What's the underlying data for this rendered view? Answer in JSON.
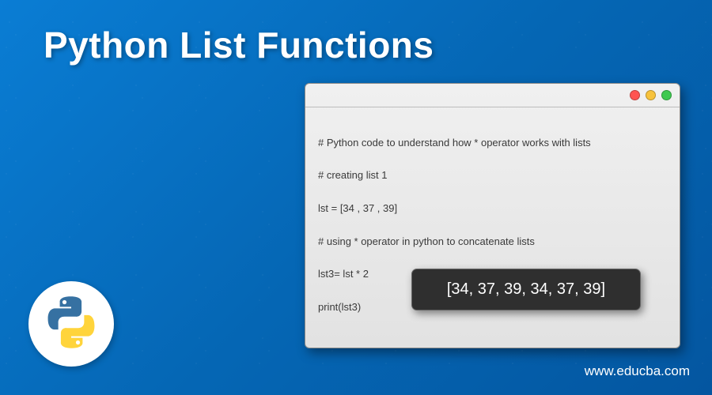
{
  "title": "Python List Functions",
  "code": {
    "line1": "# Python code to understand how * operator works with lists",
    "line2": "# creating list 1",
    "line3": "lst = [34 , 37 , 39]",
    "line4": "# using * operator in python to concatenate lists",
    "line5": "lst3= lst * 2",
    "line6": "print(lst3)"
  },
  "output": "[34, 37, 39, 34, 37, 39]",
  "site_url": "www.educba.com",
  "logo_name": "python-logo"
}
